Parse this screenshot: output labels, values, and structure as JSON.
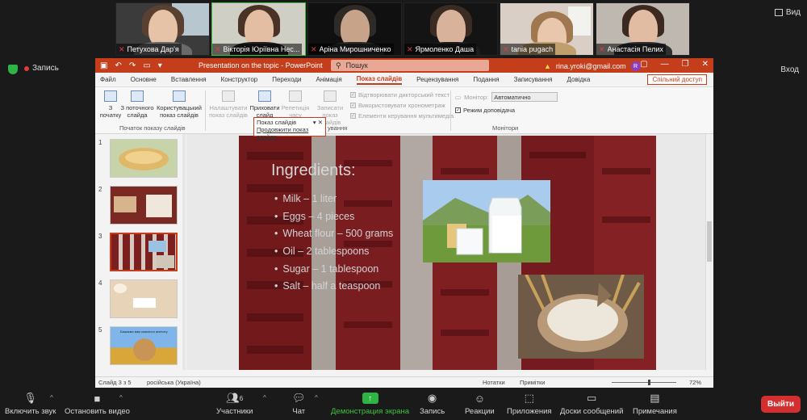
{
  "participants": [
    {
      "name": "Петухова Дар'я"
    },
    {
      "name": "Вікторія Юріївна Нес..."
    },
    {
      "name": "Аріна Мирошниченко"
    },
    {
      "name": "Ярмоленко Даша"
    },
    {
      "name": "tania pugach"
    },
    {
      "name": "Анастасія Пелих"
    }
  ],
  "top_view_label": "Вид",
  "recording_label": "Запись",
  "right_view_label": "Вход",
  "ppt": {
    "title": "Presentation on the topic - PowerPoint",
    "search_placeholder": "Пошук",
    "account": "rina.yroki@gmail.com",
    "avatar_letter": "R",
    "tabs": [
      "Файл",
      "Основне",
      "Вставлення",
      "Конструктор",
      "Переходи",
      "Анімація",
      "Показ слайдів",
      "Рецензування",
      "Подання",
      "Записування",
      "Довідка"
    ],
    "active_tab": "Показ слайдів",
    "share_label": "Спільний доступ",
    "ribbon": {
      "from_start_1": "З",
      "from_start_2": "початку",
      "from_current_1": "З поточного",
      "from_current_2": "слайда",
      "custom_1": "Користувацький",
      "custom_2": "показ слайдів",
      "group1": "Початок показу слайдів",
      "setup_1": "Налаштувати",
      "setup_2": "показ слайдів",
      "hide_1": "Приховати",
      "hide_2": "слайд",
      "rehearse_1": "Репетиція",
      "rehearse_2": "часу",
      "record_1": "Записати показ",
      "record_2": "слайдів",
      "group2_suffix": "ування",
      "chk_narration": "Відтворювати дикторський текст",
      "chk_timings": "Використовувати хронометраж",
      "chk_media": "Елементи керування мультимедіа",
      "monitor_label": "Монітор:",
      "monitor_value": "Автоматично",
      "presenter_view": "Режим доповідача",
      "group3": "Монітори"
    },
    "popup": {
      "title": "Показ слайдів",
      "action": "Продовжити показ слайда"
    },
    "thumb_numbers": [
      "1",
      "2",
      "3",
      "4",
      "5"
    ],
    "thumb5_text": "Бажаємо вам смачного апетиту",
    "slide": {
      "title": "Ingredients:",
      "bullets": [
        "Milk – 1 liter",
        "Eggs – 4 pieces",
        "Wheat flour – 500 grams",
        "Oil – 2 tablespoons",
        "Sugar – 1 tablespoon",
        "Salt – half a teaspoon"
      ]
    },
    "status": {
      "slide_of": "Слайд 3 з 5",
      "language": "російська (Україна)",
      "notes": "Нотатки",
      "comments": "Примітки",
      "zoom": "72%"
    }
  },
  "toolbar": {
    "unmute": "Включить звук",
    "video": "Остановить видео",
    "participants": "Участники",
    "participants_count": "6",
    "chat": "Чат",
    "share": "Демонстрация экрана",
    "record": "Запись",
    "reactions": "Реакции",
    "apps": "Приложения",
    "whiteboards": "Доски сообщений",
    "notes": "Примечания",
    "leave": "Выйти"
  },
  "colors": {
    "ppt_accent": "#c43e1c",
    "zoom_green": "#3ec23e",
    "leave_red": "#d32f2f"
  }
}
